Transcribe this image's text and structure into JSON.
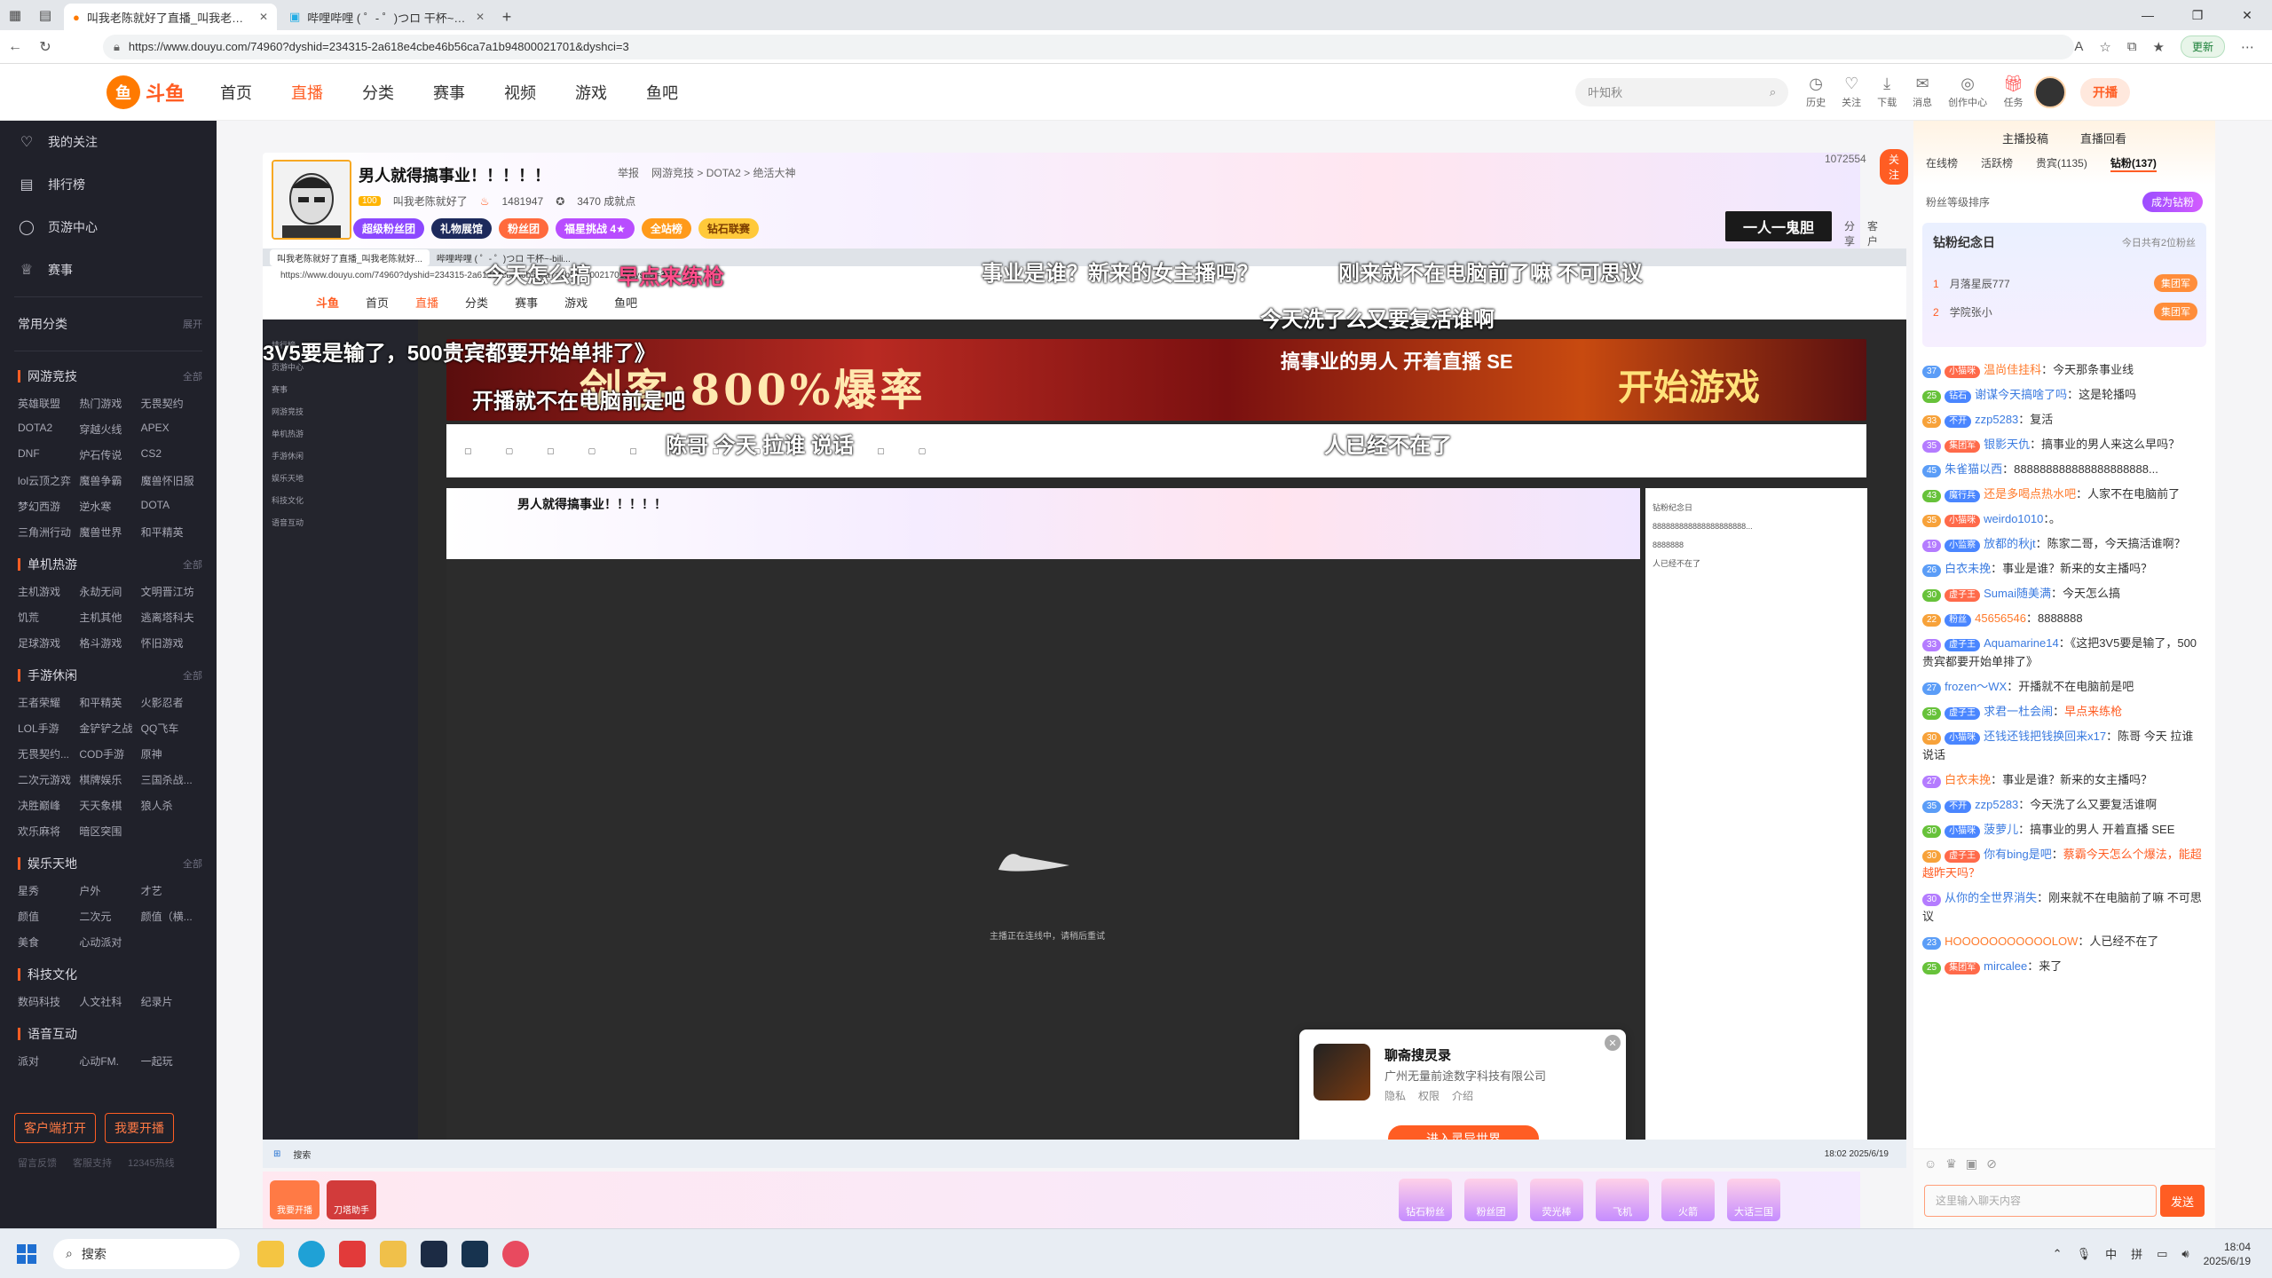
{
  "browser": {
    "tabs": [
      {
        "title": "叫我老陈就好了直播_叫我老陈就好了视频直播 - 斗鱼直播",
        "active": true
      },
      {
        "title": "哔哩哔哩 ( ゜- ゜)つロ 干杯~-bilibili",
        "active": false
      }
    ],
    "url": "https://www.douyu.com/74960?dyshid=234315-2a618e4cbe46b56ca7a1b94800021701&dyshci=3",
    "update_label": "更新"
  },
  "header": {
    "logo_text": "斗鱼",
    "nav": [
      "首页",
      "直播",
      "分类",
      "赛事",
      "视频",
      "游戏",
      "鱼吧"
    ],
    "active_nav": "直播",
    "search_placeholder": "叶知秋",
    "icons": [
      {
        "icon": "history-icon",
        "label": "历史"
      },
      {
        "icon": "follow-icon",
        "label": "关注"
      },
      {
        "icon": "download-icon",
        "label": "下载"
      },
      {
        "icon": "message-icon",
        "label": "消息",
        "badge": "28"
      },
      {
        "icon": "creator-icon",
        "label": "创作中心"
      },
      {
        "icon": "task-icon",
        "label": "任务"
      }
    ],
    "open_live": "开播"
  },
  "sidebar": {
    "top": [
      {
        "icon": "heart-icon",
        "label": "我的关注"
      },
      {
        "icon": "rank-icon",
        "label": "排行榜"
      },
      {
        "icon": "page-icon",
        "label": "页游中心"
      },
      {
        "icon": "trophy-icon",
        "label": "赛事"
      }
    ],
    "common_label": "常用分类",
    "expand": "展开",
    "sections": [
      {
        "title": "网游竞技",
        "more": "全部",
        "items": [
          "英雄联盟",
          "热门游戏",
          "无畏契约",
          "DOTA2",
          "穿越火线",
          "APEX",
          "DNF",
          "炉石传说",
          "CS2",
          "lol云顶之弈",
          "魔兽争霸",
          "魔兽怀旧服",
          "梦幻西游",
          "逆水寒",
          "DOTA",
          "三角洲行动",
          "魔兽世界",
          "和平精英"
        ]
      },
      {
        "title": "单机热游",
        "more": "全部",
        "items": [
          "主机游戏",
          "永劫无间",
          "文明晋江坊",
          "饥荒",
          "主机其他",
          "逃离塔科夫",
          "足球游戏",
          "格斗游戏",
          "怀旧游戏"
        ]
      },
      {
        "title": "手游休闲",
        "more": "全部",
        "items": [
          "王者荣耀",
          "和平精英",
          "火影忍者",
          "LOL手游",
          "金铲铲之战",
          "QQ飞车",
          "无畏契约...",
          "COD手游",
          "原神",
          "二次元游戏",
          "棋牌娱乐",
          "三国杀战...",
          "决胜巅峰",
          "天天象棋",
          "狼人杀",
          "欢乐麻将",
          "暗区突围"
        ]
      },
      {
        "title": "娱乐天地",
        "more": "全部",
        "items": [
          "星秀",
          "户外",
          "才艺",
          "颜值",
          "二次元",
          "颜值（横...",
          "美食",
          "心动派对"
        ]
      },
      {
        "title": "科技文化",
        "more": "",
        "items": [
          "数码科技",
          "人文社科",
          "纪录片"
        ]
      },
      {
        "title": "语音互动",
        "more": "",
        "items": [
          "派对",
          "心动FM.",
          "一起玩"
        ]
      }
    ],
    "client_btn": "客户端打开",
    "open_btn": "我要开播",
    "footer": [
      "留言反馈",
      "客服支持",
      "12345热线"
    ]
  },
  "room": {
    "title": "男人就得搞事业！！！！！",
    "report": "举报",
    "category": "网游竞技 > DOTA2 > 绝活大神",
    "streamer": "叫我老陈就好了",
    "level": "100",
    "heat": "1481947",
    "achievements": "3470 成就点",
    "tags": [
      "超级粉丝团",
      "礼物展馆",
      "粉丝团",
      "福星挑战 4★",
      "全站榜",
      "钻石联赛"
    ],
    "viewer_count": "1072554",
    "follow": "关注",
    "badge_text": "一人一鬼胆",
    "share": "分享",
    "client": "客户端"
  },
  "nested": {
    "tab1": "叫我老陈就好了直播_叫我老陈就好...",
    "tab2": "哔哩哔哩 ( ゜- ゜)つロ 干杯~-bili...",
    "url": "https://www.douyu.com/74960?dyshid=234315-2a618e4cbe46b56ca7a1b94800021701&dyshci=3",
    "nav": [
      "首页",
      "直播",
      "分类",
      "赛事",
      "游戏",
      "鱼吧"
    ],
    "banner_main": "剑客·800%爆率",
    "banner_side": "搞事业的男人 开着直播 SE",
    "banner_cta": "开始游戏",
    "room_title": "男人就得搞事业！！！！！",
    "loading": "主播正在连线中，请稍后重试",
    "popup_title": "聊斋搜灵录",
    "popup_company": "广州无量前途数字科技有限公司",
    "popup_links": [
      "隐私",
      "权限",
      "介绍"
    ],
    "popup_button": "进入灵异世界",
    "taskbar_search": "搜索",
    "clock_time": "18:02",
    "clock_date": "2025/6/19"
  },
  "danmaku": [
    "今天怎么搞",
    "早点来练枪",
    "事业是谁？新来的女主播吗？",
    "刚来就不在电脑前了嘛 不可思议",
    "3V5要是输了，500贵宾都要开始单排了》",
    "今天洗了么又要复活谁啊",
    "开播就不在电脑前是吧",
    "陈哥 今天 拉谁 说话",
    "人已经不在了"
  ],
  "right_panel": {
    "top_links": [
      "主播投稿",
      "直播回看"
    ],
    "tabs": [
      "在线榜",
      "活跃榜",
      "贵宾(1135)",
      "钻粉(137)"
    ],
    "active_tab": "钻粉(137)",
    "rank_note": "粉丝等级排序",
    "success_btn": "成为钻粉",
    "fans_title": "钻粉纪念日",
    "fans_sub": "今日共有2位粉丝",
    "fans_rows": [
      {
        "rank": "1",
        "name": "月落星辰777",
        "badge": "集团军"
      },
      {
        "rank": "2",
        "name": "学院张小",
        "badge": "集团军"
      }
    ],
    "chat": [
      {
        "lv": "37",
        "badge": "小猫咪",
        "name": "温尚佳挂科",
        "text": "今天那条事业线",
        "hl": false
      },
      {
        "lv": "25",
        "badge": "钻石",
        "name": "谢谋今天搞啥了吗",
        "text": "这是轮播吗",
        "hl": false
      },
      {
        "lv": "33",
        "badge": "不开",
        "name": "zzp5283",
        "text": "复活",
        "hl": false
      },
      {
        "lv": "35",
        "badge": "集团军",
        "name": "银影天仇",
        "text": "搞事业的男人来这么早吗？",
        "hl": false
      },
      {
        "lv": "45",
        "badge": "",
        "name": "朱雀猫以西",
        "text": "888888888888888888888...",
        "hl": false
      },
      {
        "lv": "43",
        "badge": "魔行兵",
        "name": "还是多喝点热水吧",
        "text": "人家不在电脑前了",
        "hl": false
      },
      {
        "lv": "35",
        "badge": "小猫咪",
        "name": "weirdo1010",
        "text": "。",
        "hl": false
      },
      {
        "lv": "19",
        "badge": "小监察",
        "name": "放都的秋jt",
        "text": "陈家二哥，今天搞活谁啊？",
        "hl": false
      },
      {
        "lv": "26",
        "badge": "",
        "name": "白衣未挽",
        "text": "事业是谁？新来的女主播吗？",
        "hl": false
      },
      {
        "lv": "30",
        "badge": "虚子王",
        "name": "Sumai随美满",
        "text": "今天怎么搞",
        "hl": false
      },
      {
        "lv": "22",
        "badge": "粉丝",
        "name": "45656546",
        "text": "8888888",
        "hl": false
      },
      {
        "lv": "33",
        "badge": "虚子王",
        "name": "Aquamarine14",
        "text": "《这把3V5要是输了，500贵宾都要开始单排了》",
        "hl": false
      },
      {
        "lv": "27",
        "badge": "",
        "name": "frozen～WX",
        "text": "开播就不在电脑前是吧",
        "hl": false
      },
      {
        "lv": "35",
        "badge": "虚子王",
        "name": "求君一杜会闹",
        "text": "早点来练枪",
        "hl": true
      },
      {
        "lv": "30",
        "badge": "小猫咪",
        "name": "还钱还钱把钱换回来x17",
        "text": "陈哥 今天 拉谁 说话",
        "hl": false
      },
      {
        "lv": "27",
        "badge": "",
        "name": "白衣未挽",
        "text": "事业是谁？新来的女主播吗？",
        "hl": false
      },
      {
        "lv": "35",
        "badge": "不开",
        "name": "zzp5283",
        "text": "今天洗了么又要复活谁啊",
        "hl": false
      },
      {
        "lv": "30",
        "badge": "小猫咪",
        "name": "菠萝儿",
        "text": "搞事业的男人 开着直播 SEE",
        "hl": false
      },
      {
        "lv": "30",
        "badge": "虚子王",
        "name": "你有bing是吧",
        "text": "蔡霸今天怎么个爆法，能超越昨天吗？",
        "hl": true
      },
      {
        "lv": "30",
        "badge": "",
        "name": "从你的全世界消失",
        "text": "刚来就不在电脑前了嘛 不可思议",
        "hl": false
      },
      {
        "lv": "23",
        "badge": "",
        "name": "HOOOOOOOOOOOLOW",
        "text": "人已经不在了",
        "hl": false
      },
      {
        "lv": "25",
        "badge": "集团军",
        "name": "mircalee",
        "text": "来了",
        "hl": false
      }
    ],
    "input_placeholder": "这里输入聊天内容",
    "send": "发送"
  },
  "gifts": {
    "left": [
      "我要开播",
      "刀塔助手"
    ],
    "items": [
      "钻石粉丝",
      "粉丝团",
      "荧光棒",
      "飞机",
      "火箭",
      "大话三国"
    ]
  },
  "taskbar": {
    "search": "搜索",
    "time": "18:04",
    "date": "2025/6/19",
    "ime": [
      "中",
      "拼"
    ]
  }
}
